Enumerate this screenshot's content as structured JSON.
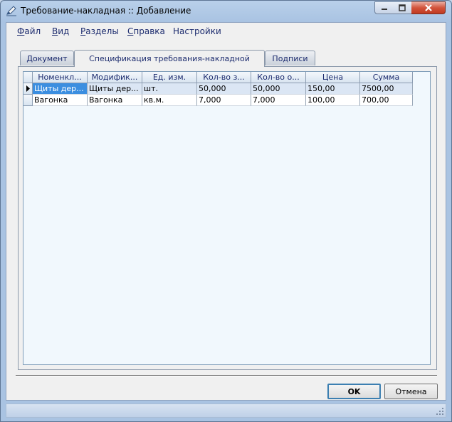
{
  "window": {
    "title": "Требование-накладная :: Добавление",
    "icons": {
      "app": "edit-pen-icon",
      "minimize": "minimize-icon",
      "maximize": "maximize-icon",
      "close": "close-icon"
    }
  },
  "menu": [
    {
      "label": "Файл",
      "key": "Ф",
      "rest": "айл"
    },
    {
      "label": "Вид",
      "key": "В",
      "rest": "ид"
    },
    {
      "label": "Разделы",
      "key": "Р",
      "rest": "азделы"
    },
    {
      "label": "Справка",
      "key": "С",
      "rest": "правка"
    },
    {
      "label": "Настройки",
      "key": "",
      "rest": "Настройки"
    }
  ],
  "tabs": [
    {
      "label": "Документ",
      "active": false
    },
    {
      "label": "Спецификация требования-накладной",
      "active": true
    },
    {
      "label": "Подписи",
      "active": false
    }
  ],
  "grid": {
    "columns": [
      "Номенкл...",
      "Модифик...",
      "Ед. изм.",
      "Кол-во з...",
      "Кол-во о...",
      "Цена",
      "Сумма"
    ],
    "rows": [
      [
        "Щиты дер...",
        "Щиты дер...",
        "шт.",
        "50,000",
        "50,000",
        "150,00",
        "7500,00"
      ],
      [
        "Вагонка",
        "Вагонка",
        "кв.м.",
        "7,000",
        "7,000",
        "100,00",
        "700,00"
      ]
    ],
    "current_row_icon": "row-pointer-icon",
    "selection_color": "#3b8ee0"
  },
  "buttons": {
    "ok": "OK",
    "cancel": "Отмена"
  },
  "statusbar": {
    "grip_icon": "resize-grip-icon"
  }
}
